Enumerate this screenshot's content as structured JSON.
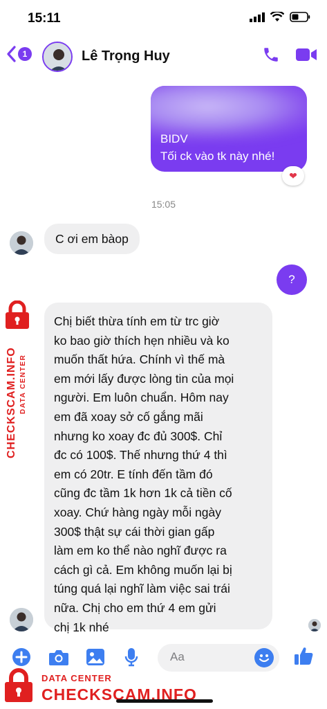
{
  "status_bar": {
    "time": "15:11"
  },
  "header": {
    "back_badge": "1",
    "contact_name": "Lê Trọng Huy"
  },
  "messages": {
    "outgoing_top": {
      "line1": "BIDV",
      "line2": "Tối ck vào tk này nhé!",
      "reaction": "❤"
    },
    "timestamp": "15:05",
    "incoming_short": "C ơi em bàop",
    "outgoing_question": "?",
    "incoming_long": [
      "Chị biết thừa tính em từ trc giờ",
      "ko bao giờ thích hẹn nhiều và ko",
      "muốn thất hứa. Chính vì thế mà",
      "em mới lấy được lòng tin của mọi",
      "người. Em luôn chuẩn. Hôm nay",
      "em đã xoay sở cố gắng mãi",
      "nhưng ko xoay đc đủ 300$. Chỉ",
      "đc có 100$. Thế nhưng thứ 4 thì",
      "em có 20tr. E tính đến tầm đó",
      "cũng đc tầm 1k hơn 1k cả tiền cố",
      "xoay. Chứ hàng ngày mỗi ngày",
      "300$ thật sự cái thời gian gấp",
      "làm em ko thể nào nghĩ được ra",
      "cách gì cả. Em không muốn lại bị",
      "túng quá lại nghĩ làm việc sai trái",
      "nữa. Chị cho em thứ 4 em gửi",
      "chị 1k nhé"
    ]
  },
  "composer": {
    "placeholder": "Aa"
  },
  "watermark": {
    "label": "DATA CENTER",
    "brand": "CHECKSCAM.INFO"
  },
  "colors": {
    "accent": "#7a3cf0",
    "incoming_bubble": "#efeff0",
    "watermark": "#e02020",
    "composer_icons": "#3d7ef0"
  }
}
